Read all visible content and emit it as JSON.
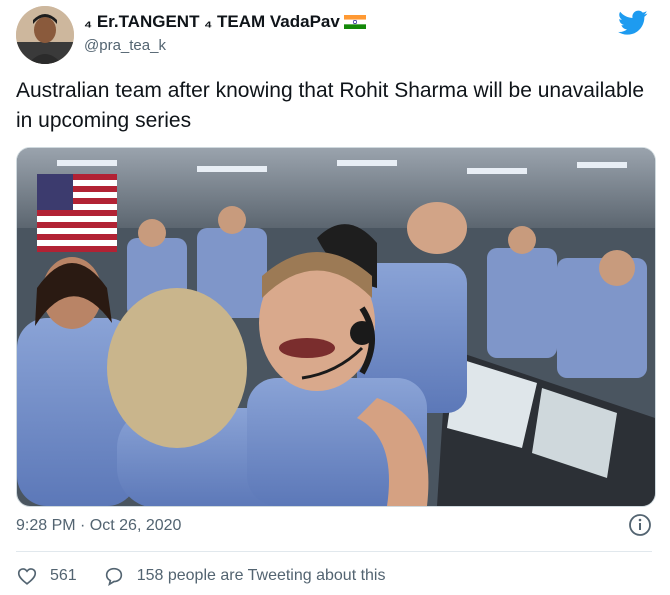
{
  "tweet": {
    "display_name": "₄ Er.TANGENT ₄ TEAM VadaPav",
    "name_icon": "lightning-symbol-icon",
    "flag_icon": "india-flag-icon",
    "handle": "@pra_tea_k",
    "text": "Australian team after knowing that Rohit Sharma will be unavailable in upcoming series",
    "timestamp": "9:28 PM · Oct 26, 2020",
    "likes_count": "561",
    "replies_text": "158 people are Tweeting about this"
  },
  "colors": {
    "twitter_blue": "#1d9bf0",
    "secondary_text": "#536471",
    "primary_text": "#0f1419",
    "divider": "#e1e8ed"
  },
  "icons": {
    "brand": "twitter-bird-icon",
    "info": "info-icon",
    "like": "heart-icon",
    "reply": "speech-bubble-icon"
  }
}
